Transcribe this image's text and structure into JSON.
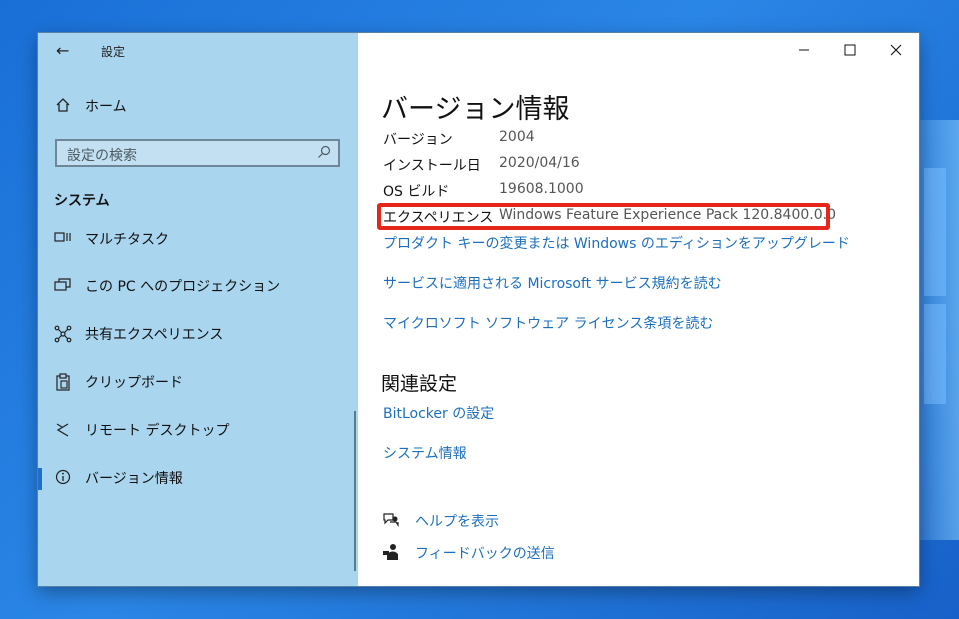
{
  "app": {
    "title": "設定",
    "back_glyph": "←"
  },
  "window_controls": {
    "minimize": "—",
    "maximize": "☐",
    "close": "✕"
  },
  "sidebar": {
    "home_label": "ホーム",
    "search": {
      "placeholder": "設定の検索"
    },
    "section_title": "システム",
    "items": [
      {
        "label": "マルチタスク",
        "icon": "multitasking-icon"
      },
      {
        "label": "この PC へのプロジェクション",
        "icon": "projection-icon"
      },
      {
        "label": "共有エクスペリエンス",
        "icon": "shared-experience-icon"
      },
      {
        "label": "クリップボード",
        "icon": "clipboard-icon"
      },
      {
        "label": "リモート デスクトップ",
        "icon": "remote-desktop-icon"
      },
      {
        "label": "バージョン情報",
        "icon": "info-icon",
        "active": true
      }
    ]
  },
  "main": {
    "title": "バージョン情報",
    "specs": [
      {
        "label": "バージョン",
        "value": "2004"
      },
      {
        "label": "インストール日",
        "value": "2020/04/16"
      },
      {
        "label": "OS ビルド",
        "value": "19608.1000"
      },
      {
        "label": "エクスペリエンス",
        "value": "Windows Feature Experience Pack 120.8400.0.0"
      }
    ],
    "links": [
      "プロダクト キーの変更または Windows のエディションをアップグレード",
      "サービスに適用される Microsoft サービス規約を読む",
      "マイクロソフト ソフトウェア ライセンス条項を読む"
    ],
    "related": {
      "title": "関連設定",
      "links": [
        "BitLocker の設定",
        "システム情報"
      ]
    },
    "help": {
      "help_label": "ヘルプを表示",
      "feedback_label": "フィードバックの送信"
    }
  },
  "colors": {
    "accent": "#1d6fbd",
    "highlight_border": "#e5261a",
    "sidebar_bg": "#a9d5ee"
  }
}
